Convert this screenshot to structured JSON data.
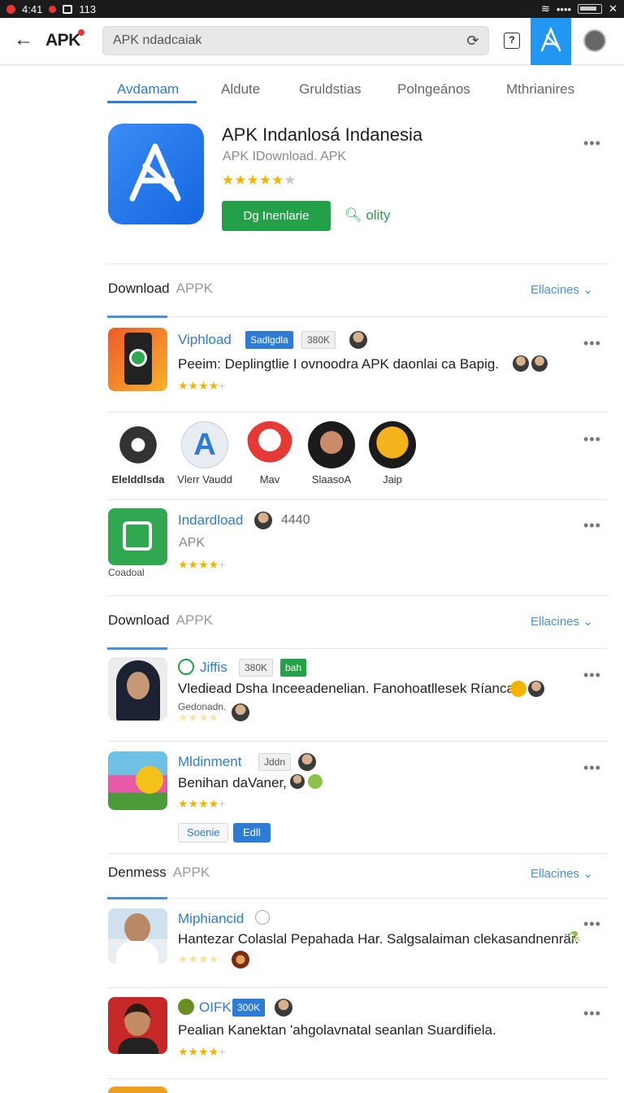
{
  "status": {
    "time": "4:41",
    "info": "113"
  },
  "header": {
    "brand": "APK",
    "search_value": "APK ndadcaiak"
  },
  "tabs": [
    "Avdamam",
    "Aldute",
    "Gruldstias",
    "Polngeános",
    "Mthrianires"
  ],
  "app": {
    "title": "APK Indanlosá Indanesia",
    "subtitle": "APK IDownload. APK",
    "install_label": "Dg Inenlarie",
    "search_label": "olity"
  },
  "sections": [
    {
      "title": "Download",
      "muted": "APPK",
      "link": "Ellacines"
    },
    {
      "title": "Download",
      "muted": "APPK",
      "link": "Ellacines"
    },
    {
      "title": "Denmess",
      "muted": "APPK",
      "link": "Ellacines"
    }
  ],
  "items": {
    "i1": {
      "title": "Viphload",
      "badge": "Sadlgdla",
      "count": "380K",
      "desc": "Peeim: Deplingtlie I ovnoodra APK daonlai ca Bapig."
    },
    "i2": {
      "title": "Indardload",
      "count": "4440",
      "sub": "APK",
      "caption": "Coadoal"
    },
    "i3": {
      "title": "Jiffis",
      "count": "380K",
      "badge": "bah",
      "desc": "Vlediead Dsha Inceeadenelian. Fanohoatllesek Ríancal.",
      "sub": "Gedonadn."
    },
    "i4": {
      "title": "Mldinment",
      "tag": "Jddn",
      "desc": "Benihan daVaner,",
      "chip1": "Soenie",
      "chip2": "Edll"
    },
    "i5": {
      "title": "Miphiancid",
      "desc": "Hantezar Colaslal Pepahada Har. Salgsalaiman clekasandnenrär."
    },
    "i6": {
      "title": "OIFK",
      "badge": "300K",
      "desc": "Pealian Kanektan 'ahgolavnatal seanlan Suardifiela."
    }
  },
  "carousel": [
    "Elelddlsda",
    "Vlerr Vaudd",
    "Mav",
    "SlaasoA",
    "Jaip"
  ],
  "colors": {
    "accent": "#2e7bd6",
    "green": "#24a148",
    "star": "#f2b400"
  }
}
